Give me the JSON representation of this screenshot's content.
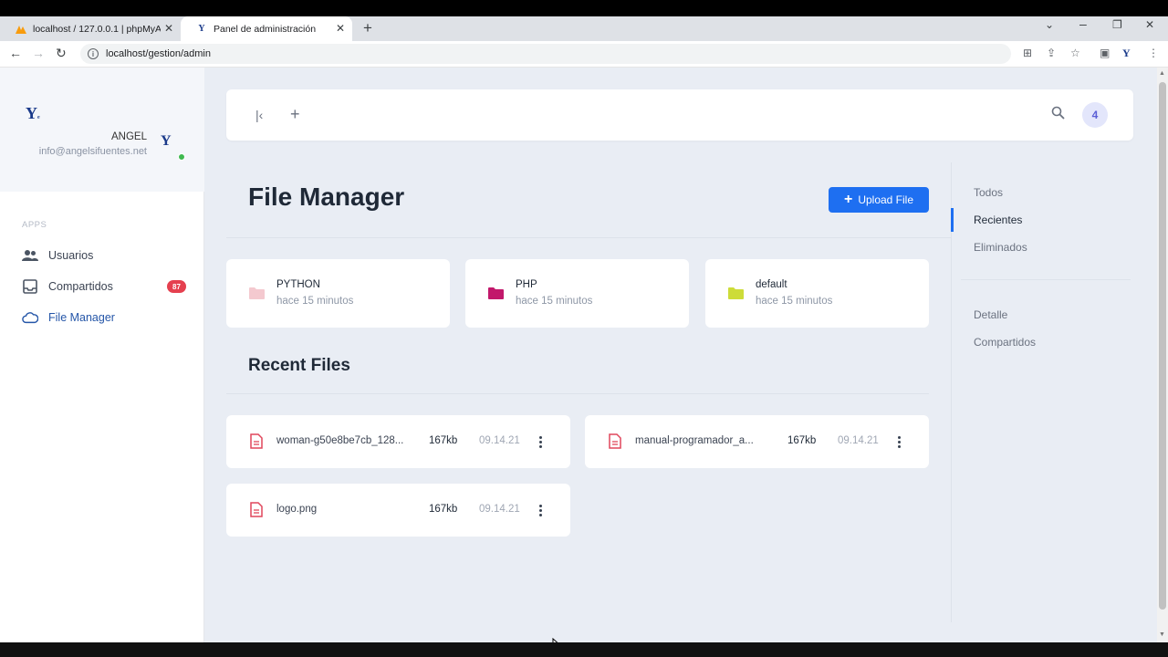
{
  "browser": {
    "tabs": [
      {
        "title": "localhost / 127.0.0.1 | phpMyAdm"
      },
      {
        "title": "Panel de administración"
      }
    ],
    "url": "localhost/gestion/admin"
  },
  "sidebar": {
    "user_name": "ANGEL",
    "user_email": "info@angelsifuentes.net",
    "section_label": "APPS",
    "items": [
      {
        "label": "Usuarios"
      },
      {
        "label": "Compartidos",
        "badge": "87"
      },
      {
        "label": "File Manager",
        "active": true
      }
    ]
  },
  "topbar": {
    "count": "4"
  },
  "main": {
    "title": "File Manager",
    "upload_label": "Upload File",
    "folders": [
      {
        "name": "PYTHON",
        "time": "hace 15 minutos",
        "color": "#f4c9cf"
      },
      {
        "name": "PHP",
        "time": "hace 15 minutos",
        "color": "#c2186b"
      },
      {
        "name": "default",
        "time": "hace 15 minutos",
        "color": "#cddc39"
      }
    ],
    "recent_title": "Recent Files",
    "files": [
      {
        "name": "woman-g50e8be7cb_128...",
        "size": "167kb",
        "date": "09.14.21"
      },
      {
        "name": "manual-programador_a...",
        "size": "167kb",
        "date": "09.14.21"
      },
      {
        "name": "logo.png",
        "size": "167kb",
        "date": "09.14.21"
      }
    ]
  },
  "right_panel": {
    "items": [
      {
        "label": "Todos"
      },
      {
        "label": "Recientes",
        "active": true
      },
      {
        "label": "Eliminados"
      },
      {
        "label": "Detalle"
      },
      {
        "label": "Compartidos"
      }
    ]
  },
  "colors": {
    "accent": "#1e6ff1",
    "badge": "#e5404f",
    "file_icon": "#e0475b",
    "background": "#e9edf4"
  }
}
